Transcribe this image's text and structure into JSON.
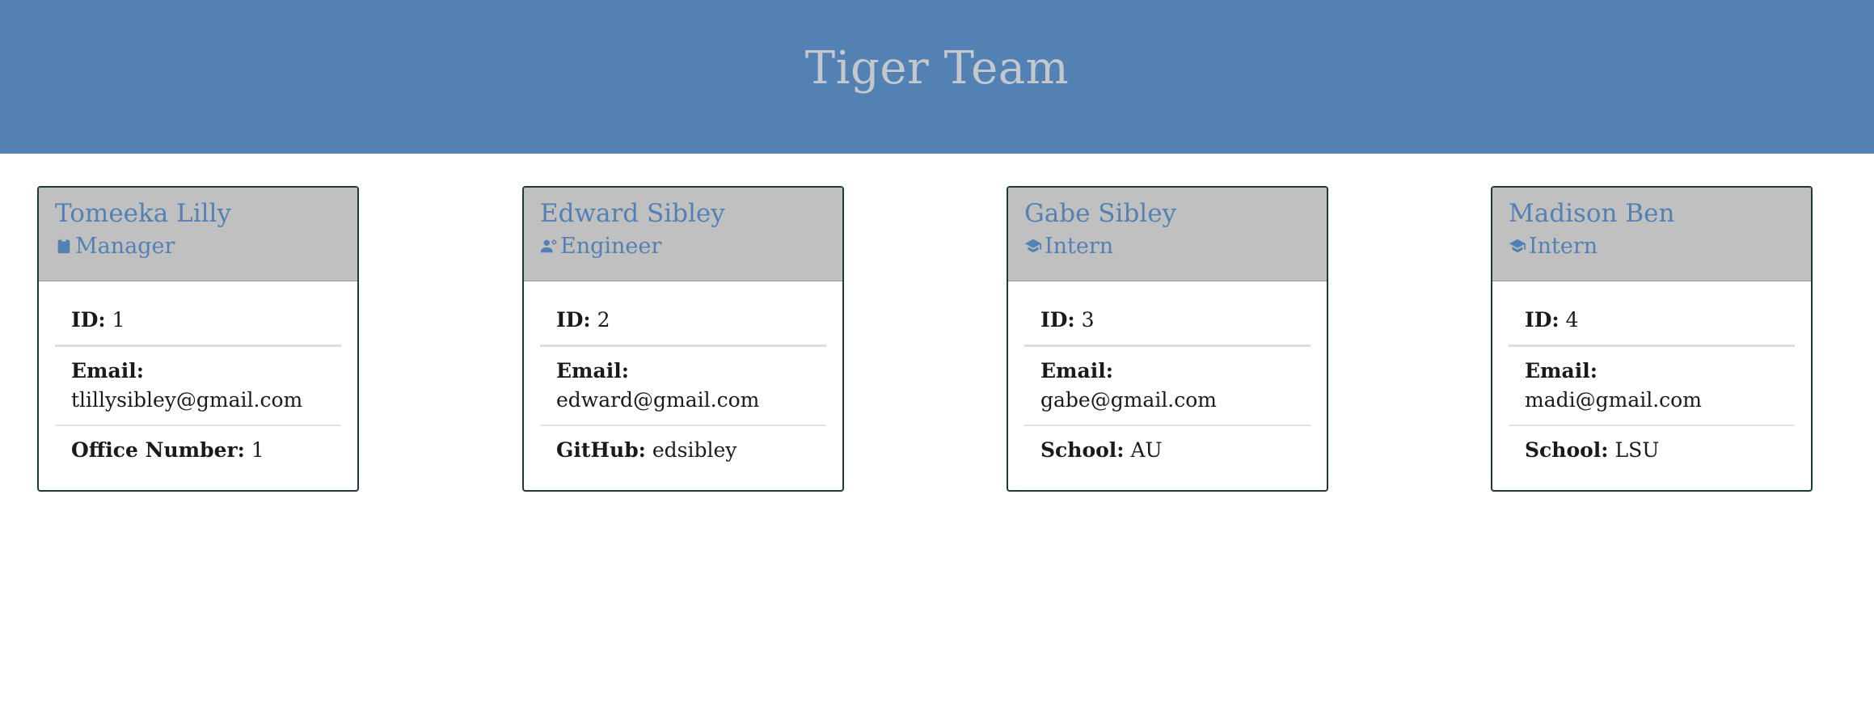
{
  "header": {
    "title": "Tiger Team"
  },
  "cards": [
    {
      "name": "Tomeeka Lilly",
      "role": "Manager",
      "role_icon": "clipboard-icon",
      "id_label": "ID:",
      "id_value": "1",
      "email_label": "Email:",
      "email_value": "tlillysibley@gmail.com",
      "extra_label": "Office Number:",
      "extra_value": "1"
    },
    {
      "name": "Edward Sibley",
      "role": "Engineer",
      "role_icon": "user-gear-icon",
      "id_label": "ID:",
      "id_value": "2",
      "email_label": "Email:",
      "email_value": "edward@gmail.com",
      "extra_label": "GitHub:",
      "extra_value": "edsibley"
    },
    {
      "name": "Gabe Sibley",
      "role": "Intern",
      "role_icon": "graduation-cap-icon",
      "id_label": "ID:",
      "id_value": "3",
      "email_label": "Email:",
      "email_value": "gabe@gmail.com",
      "extra_label": "School:",
      "extra_value": "AU"
    },
    {
      "name": "Madison Ben",
      "role": "Intern",
      "role_icon": "graduation-cap-icon",
      "id_label": "ID:",
      "id_value": "4",
      "email_label": "Email:",
      "email_value": "madi@gmail.com",
      "extra_label": "School:",
      "extra_value": "LSU"
    }
  ],
  "colors": {
    "header_bg": "#5381b3",
    "header_text": "#c4c8cc",
    "card_head_bg": "#c0c0c0",
    "accent": "#5381b3"
  }
}
